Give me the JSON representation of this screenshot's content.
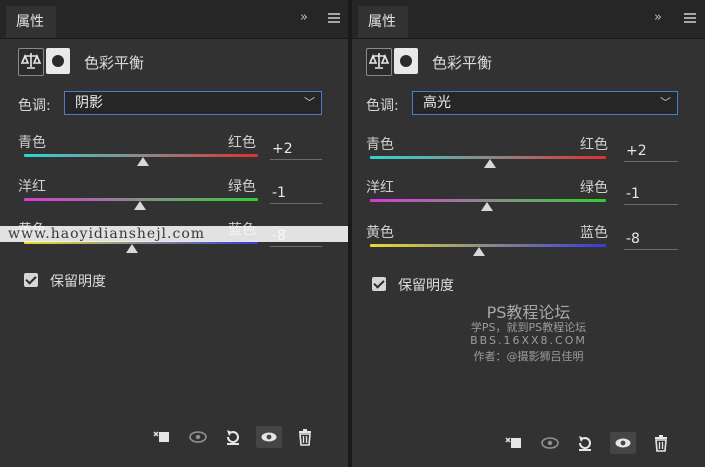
{
  "panels": [
    {
      "tab_label": "属性",
      "adjustment_title": "色彩平衡",
      "tone_label": "色调:",
      "tone_value": "阴影",
      "sliders": [
        {
          "left": "青色",
          "right": "红色",
          "value": "+2",
          "value_num": 2,
          "from": "#2fd4d4",
          "to": "#e02f2f"
        },
        {
          "left": "洋红",
          "right": "绿色",
          "value": "-1",
          "value_num": -1,
          "from": "#d83ad8",
          "to": "#2fd02f"
        },
        {
          "left": "黄色",
          "right": "蓝色",
          "value": "-8",
          "value_num": -8,
          "from": "#e6e02a",
          "to": "#3a3ad8"
        }
      ],
      "preserve_label": "保留明度",
      "preserve_checked": true
    },
    {
      "tab_label": "属性",
      "adjustment_title": "色彩平衡",
      "tone_label": "色调:",
      "tone_value": "高光",
      "sliders": [
        {
          "left": "青色",
          "right": "红色",
          "value": "+2",
          "value_num": 2,
          "from": "#2fd4d4",
          "to": "#e02f2f"
        },
        {
          "left": "洋红",
          "right": "绿色",
          "value": "-1",
          "value_num": -1,
          "from": "#d83ad8",
          "to": "#2fd02f"
        },
        {
          "left": "黄色",
          "right": "蓝色",
          "value": "-8",
          "value_num": -8,
          "from": "#e6e02a",
          "to": "#3a3ad8"
        }
      ],
      "preserve_label": "保留明度",
      "preserve_checked": true
    }
  ],
  "slider_range": [
    -100,
    100
  ],
  "watermark": "www.haoyidianshejl.com",
  "credits": {
    "forum": "PS教程论坛",
    "slogan": "学PS，就到PS教程论坛",
    "site": "BBS.16XX8.COM",
    "author": "作者：@摄影狮吕佳明"
  },
  "icons": {
    "collapse": "»",
    "menu": "menu-icon",
    "bottom": [
      "clip-to-layer-icon",
      "view-previous-icon",
      "reset-icon",
      "visibility-eye-icon",
      "trash-icon"
    ]
  },
  "colors": {
    "panel_bg": "#323232",
    "accent_border": "#4a7ec2"
  }
}
